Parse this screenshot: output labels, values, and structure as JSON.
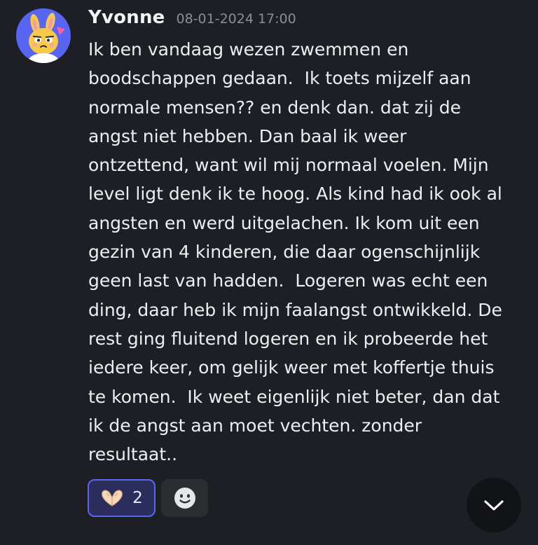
{
  "message": {
    "author": "Yvonne",
    "timestamp": "08-01-2024 17:00",
    "lines": [
      "Ik ben vandaag wezen zwemmen en",
      "boodschappen gedaan.  Ik toets mijzelf aan",
      "normale mensen?? en denk dan. dat zij de",
      "angst niet hebben. Dan baal ik weer",
      "ontzettend, want wil mij normaal voelen. Mijn",
      "level ligt denk ik te hoog. Als kind had ik ook al",
      "angsten en werd uitgelachen. Ik kom uit een",
      "gezin van 4 kinderen, die daar ogenschijnlijk",
      "geen last van hadden.  Logeren was echt een",
      "ding, daar heb ik mijn faalangst ontwikkeld. De",
      "rest ging fluitend logeren en ik probeerde het",
      "iedere keer, om gelijk weer met koffertje thuis",
      "te komen.  Ik weet eigenlijk niet beter, dan dat",
      "ik de angst aan moet vechten. zonder",
      "resultaat.."
    ]
  },
  "reactions": [
    {
      "emoji_icon": "heart-hands-icon",
      "count": "2",
      "active": true
    }
  ],
  "icons": {
    "add_reaction": "smiley-face-icon",
    "scroll_down": "chevron-down-icon",
    "avatar": "yellow-rabbit-avatar"
  },
  "colors": {
    "background": "#1e1f24",
    "text": "#eceef1",
    "timestamp": "#8b8e96",
    "reaction_border": "#5865f2",
    "reaction_fill": "#2b2d5c",
    "button_fill": "#2b2d31",
    "avatar_bg": "#5865f2"
  }
}
